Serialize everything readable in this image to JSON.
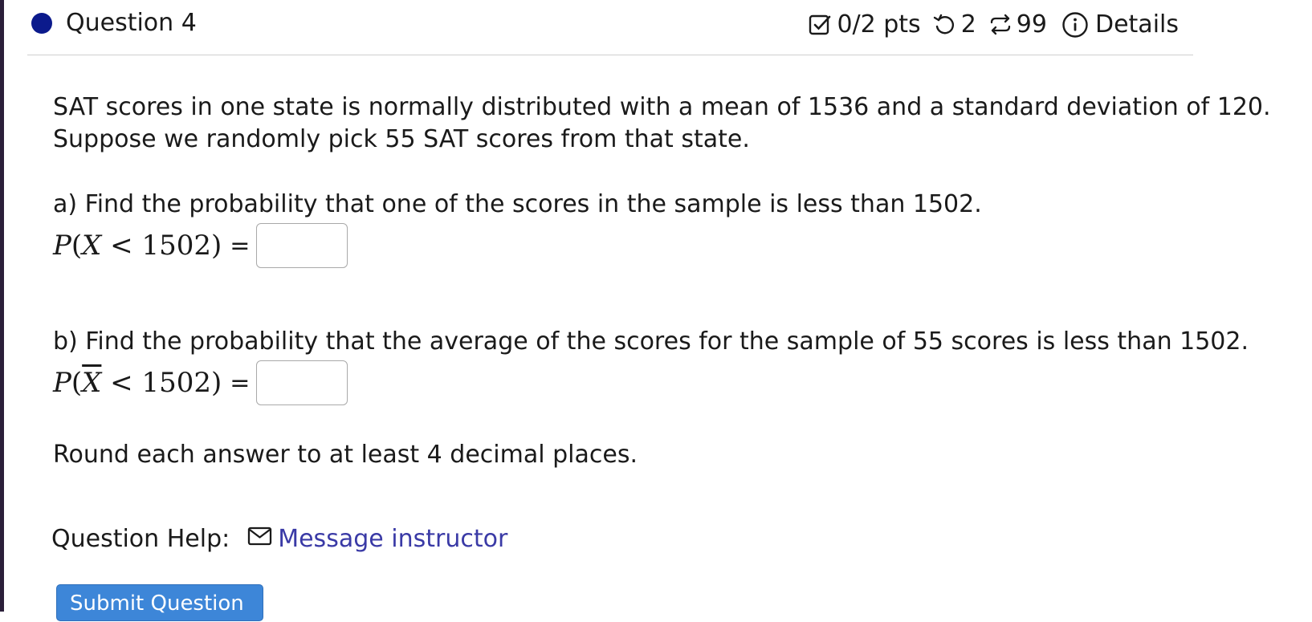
{
  "question": {
    "title": "Question 4",
    "points": "0/2 pts",
    "attempts": "2",
    "regenerations": "99",
    "details_label": "Details"
  },
  "body": {
    "intro_line1": "SAT scores in one state is normally distributed with a mean of 1536 and a standard deviation of 120.",
    "intro_line2": "Suppose we randomly pick 55 SAT scores from that state.",
    "part_a_prompt": "a) Find the probability that one of the scores in the sample is less than 1502.",
    "part_a_P": "P",
    "part_a_var": "X",
    "part_a_rest": " < 1502)",
    "part_a_answer": "",
    "part_b_prompt": "b) Find the probability that the average of the scores for the sample of 55 scores is less than 1502.",
    "part_b_P": "P",
    "part_b_var": "X",
    "part_b_rest": " < 1502)",
    "part_b_answer": "",
    "equals": "=",
    "rounding_note": "Round each answer to at least 4 decimal places."
  },
  "help": {
    "label": "Question Help:",
    "message_link": "Message instructor"
  },
  "actions": {
    "submit_label": "Submit Question"
  },
  "colors": {
    "dot": "#0b1a8c",
    "link": "#3a3aa6",
    "submit_bg": "#3d86d8"
  }
}
